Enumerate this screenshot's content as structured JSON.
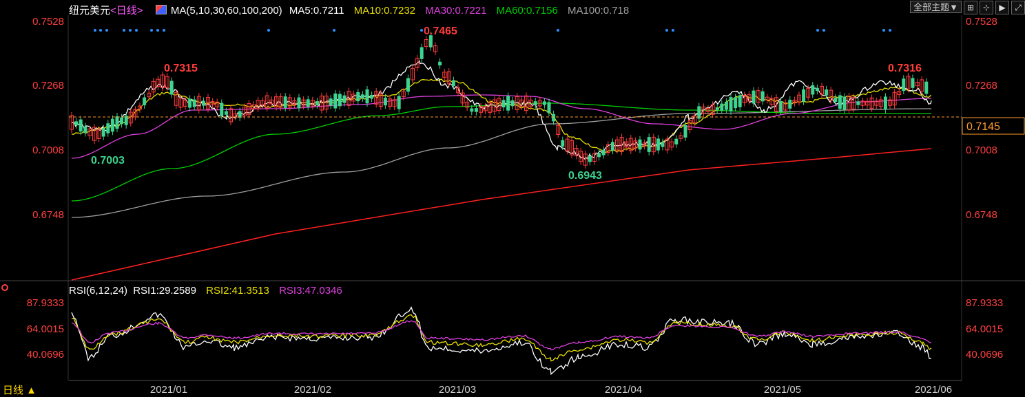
{
  "header": {
    "symbol": "纽元美元",
    "period_tag": "<日线>",
    "ma_title": "MA(5,10,30,60,100,200)",
    "ma5": "MA5:0.7211",
    "ma10": "MA10:0.7232",
    "ma30": "MA30:0.7221",
    "ma60": "MA60:0.7156",
    "ma100": "MA100:0.718"
  },
  "toolbar": {
    "theme_button": "全部主题▼",
    "icons": [
      "grid-icon",
      "crosshair-icon",
      "play-icon",
      "expand-icon"
    ]
  },
  "price_panel": {
    "axis_labels": [
      "0.7528",
      "0.7268",
      "0.7008",
      "0.6748"
    ],
    "current_price": "0.7145",
    "annotations": {
      "high1": "0.7315",
      "high2": "0.7465",
      "high3": "0.7316",
      "low1": "0.7003",
      "low2": "0.6943"
    }
  },
  "rsi_panel": {
    "title": "RSI(6,12,24)",
    "rsi1": "RSI1:29.2589",
    "rsi2": "RSI2:41.3513",
    "rsi3": "RSI3:47.0346",
    "axis_labels": [
      "87.9333",
      "64.0015",
      "40.0696"
    ]
  },
  "x_axis": {
    "labels": [
      "2021/01",
      "2021/02",
      "2021/03",
      "2021/04",
      "2021/05",
      "2021/06"
    ]
  },
  "footer": {
    "period": "日线 ▲"
  },
  "colors": {
    "up": "#ff3c3c",
    "down": "#3cd490",
    "ma5": "#ffffff",
    "ma10": "#e8e000",
    "ma30": "#e040e0",
    "ma60": "#00d000",
    "ma100": "#a0a0a0",
    "ma200": "#ff2020"
  }
}
